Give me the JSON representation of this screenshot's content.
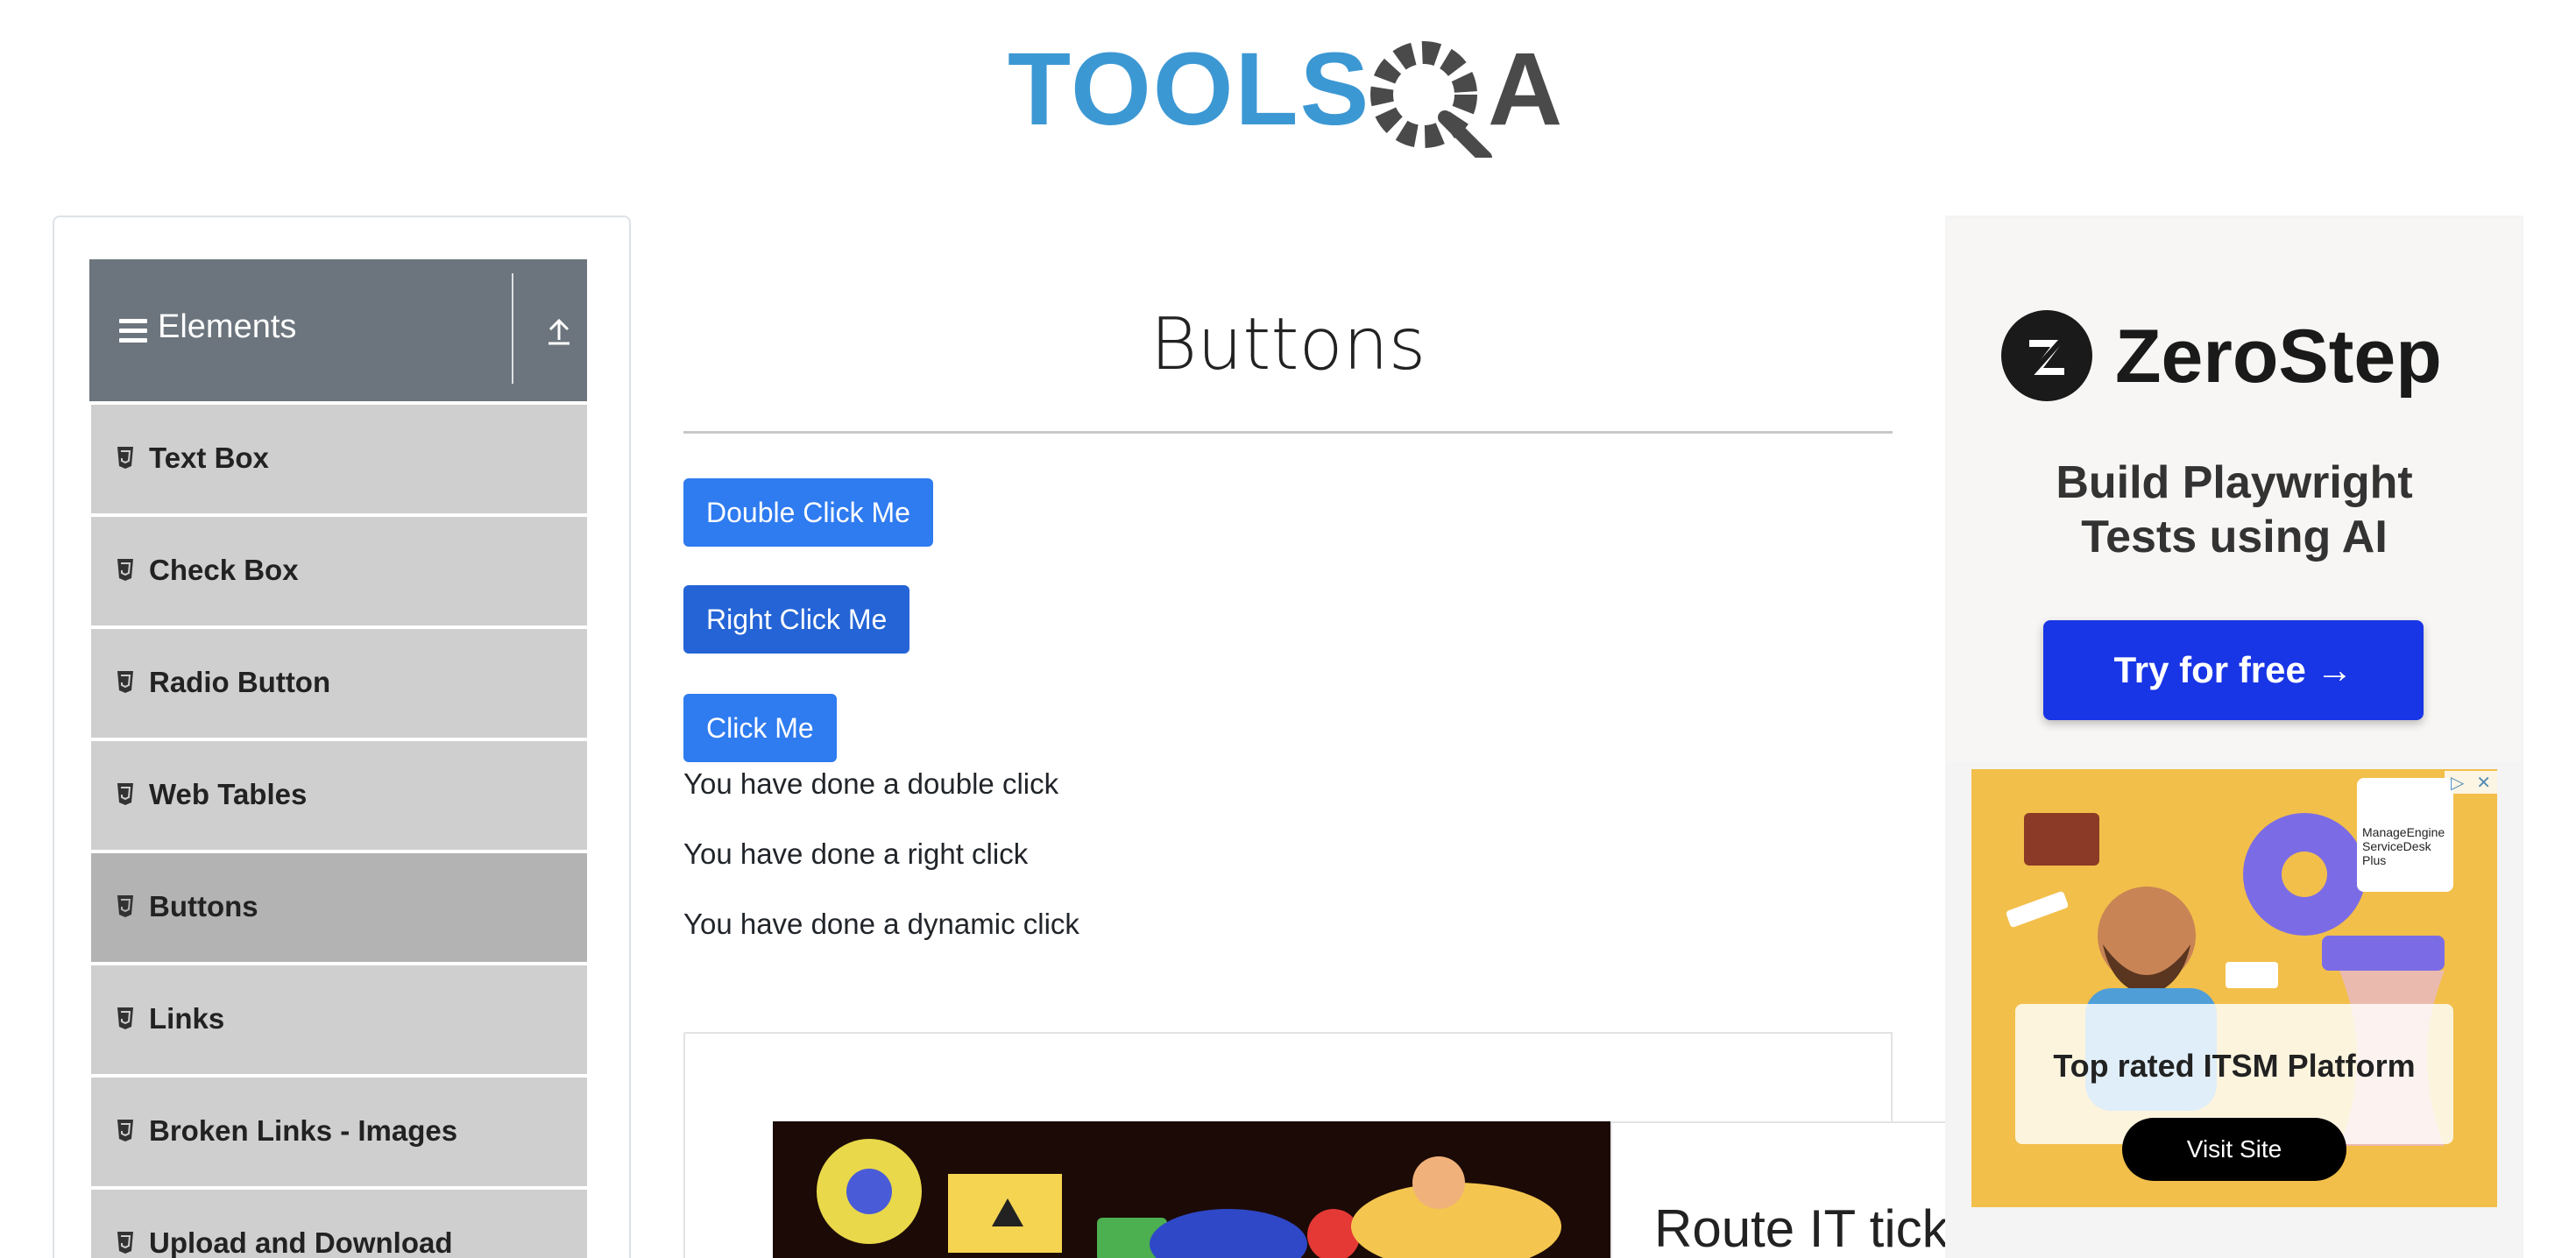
{
  "header": {
    "logo_text": "TOOLSQA"
  },
  "sidebar": {
    "group_title": "Elements",
    "items": [
      {
        "label": "Text Box"
      },
      {
        "label": "Check Box"
      },
      {
        "label": "Radio Button"
      },
      {
        "label": "Web Tables"
      },
      {
        "label": "Buttons",
        "active": true
      },
      {
        "label": "Links"
      },
      {
        "label": "Broken Links - Images"
      },
      {
        "label": "Upload and Download"
      }
    ]
  },
  "main": {
    "title": "Buttons",
    "buttons": {
      "double_click": "Double Click Me",
      "right_click": "Right Click Me",
      "click": "Click Me"
    },
    "messages": {
      "double": "You have done a double click",
      "right": "You have done a right click",
      "dynamic": "You have done a dynamic click"
    },
    "bottom_ad_headline": "Route IT tick"
  },
  "right_ad": {
    "brand": "ZeroStep",
    "tagline_line1": "Build Playwright",
    "tagline_line2": "Tests using AI",
    "cta": "Try for free →",
    "second_ad": {
      "brand_line1": "ManageEngine",
      "brand_line2": "ServiceDesk Plus",
      "headline": "Top rated ITSM Platform",
      "cta": "Visit Site"
    }
  },
  "colors": {
    "primary_button": "#2f7bf0",
    "sidebar_header": "#6c757d",
    "sidebar_item": "#cfcfcf",
    "sidebar_item_active": "#b3b3b3",
    "zerostep_cta": "#1835e6"
  }
}
